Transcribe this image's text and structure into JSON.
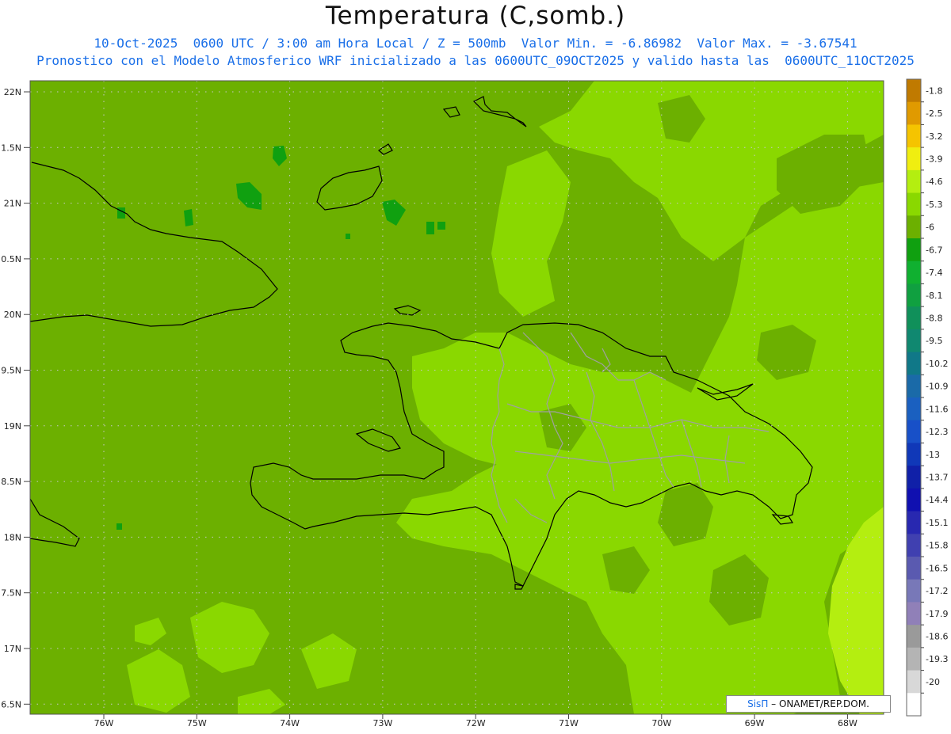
{
  "header": {
    "title": "Temperatura (C,somb.)",
    "line1": "10-Oct-2025  0600 UTC / 3:00 am Hora Local / Z = 500mb  Valor Min. = -6.86982  Valor Max. = -3.67541",
    "line2": "Pronostico con el Modelo Atmosferico WRF inicializado a las 0600UTC_09OCT2025 y valido hasta las  0600UTC_11OCT2025"
  },
  "axes": {
    "lat_labels": [
      "22N",
      "1.5N",
      "21N",
      "0.5N",
      "20N",
      "9.5N",
      "19N",
      "8.5N",
      "18N",
      "7.5N",
      "17N",
      "6.5N"
    ],
    "lon_labels": [
      "76W",
      "75W",
      "74W",
      "73W",
      "72W",
      "71W",
      "70W",
      "69W",
      "68W"
    ]
  },
  "colorbar": {
    "labels": [
      "-1.8",
      "-2.5",
      "-3.2",
      "-3.9",
      "-4.6",
      "-5.3",
      "-6",
      "-6.7",
      "-7.4",
      "-8.1",
      "-8.8",
      "-9.5",
      "-10.2",
      "-10.9",
      "-11.6",
      "-12.3",
      "-13",
      "-13.7",
      "-14.4",
      "-15.1",
      "-15.8",
      "-16.5",
      "-17.2",
      "-17.9",
      "-18.6",
      "-19.3",
      "-20"
    ],
    "colors": [
      "#c07a00",
      "#e09a00",
      "#f5c400",
      "#f0ee10",
      "#b4ee10",
      "#8ad800",
      "#6cb000",
      "#10a010",
      "#10b030",
      "#10a040",
      "#10905a",
      "#108870",
      "#107888",
      "#1a6aa8",
      "#1a60c0",
      "#1850c8",
      "#1038b8",
      "#1020a8",
      "#1010b0",
      "#2828b0",
      "#4040b0",
      "#5a5ab0",
      "#7878b8",
      "#9080b8",
      "#9a9a9a",
      "#b4b4b4",
      "#d8d8d8"
    ]
  },
  "field_colors": {
    "base": "#6cb000",
    "warm": "#8ad800",
    "warmer": "#b4ee10",
    "cold": "#10a010"
  },
  "credit": {
    "sis": "SisΠ",
    "rest": "– ONAMET/REP.DOM."
  }
}
